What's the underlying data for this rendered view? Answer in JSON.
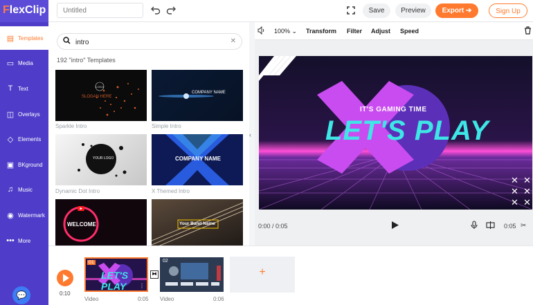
{
  "app": {
    "brand_prefix": "F",
    "brand_rest": "lexClip",
    "title_placeholder": "Untitled"
  },
  "topbar": {
    "save_label": "Save",
    "preview_label": "Preview",
    "export_label": "Export",
    "signup_label": "Sign Up"
  },
  "sidebar": {
    "items": [
      {
        "label": "Templates",
        "icon": "templates-icon"
      },
      {
        "label": "Media",
        "icon": "folder-icon"
      },
      {
        "label": "Text",
        "icon": "text-icon"
      },
      {
        "label": "Overlays",
        "icon": "overlays-icon"
      },
      {
        "label": "Elements",
        "icon": "elements-icon"
      },
      {
        "label": "BKground",
        "icon": "background-icon"
      },
      {
        "label": "Music",
        "icon": "music-icon"
      },
      {
        "label": "Watermark",
        "icon": "watermark-icon"
      },
      {
        "label": "More",
        "icon": "more-icon"
      }
    ]
  },
  "search": {
    "value": "intro",
    "count_label": "192 \"intro\" Templates"
  },
  "templates": [
    {
      "label": "Sparkle Intro",
      "text": "SLOGAN HERE"
    },
    {
      "label": "Simple Intro",
      "text": "COMPANY NAME"
    },
    {
      "label": "Dynamic Dot Intro",
      "text": "YOUR LOGO"
    },
    {
      "label": "X Themed Intro",
      "text": "COMPANY NAME"
    },
    {
      "label": "",
      "text": "WELCOME"
    },
    {
      "label": "",
      "text": "Your Band Name"
    }
  ],
  "editor": {
    "zoom": "100%",
    "tools": [
      "Transform",
      "Filter",
      "Adjust",
      "Speed"
    ],
    "canvas_subtitle": "IT'S GAMING TIME",
    "canvas_title": "LET'S PLAY",
    "current_time": "0:00 / 0:05",
    "clip_duration": "0:05"
  },
  "timeline": {
    "total": "0:10",
    "clips": [
      {
        "index": "01",
        "type": "Video",
        "duration": "0:05",
        "title": "LET'S PLAY"
      },
      {
        "index": "02",
        "type": "Video",
        "duration": "0:06"
      }
    ]
  },
  "colors": {
    "brand": "#4f3dc9",
    "accent": "#ff7a2f",
    "magenta": "#c94cf0",
    "cyan": "#3ee6e6"
  }
}
